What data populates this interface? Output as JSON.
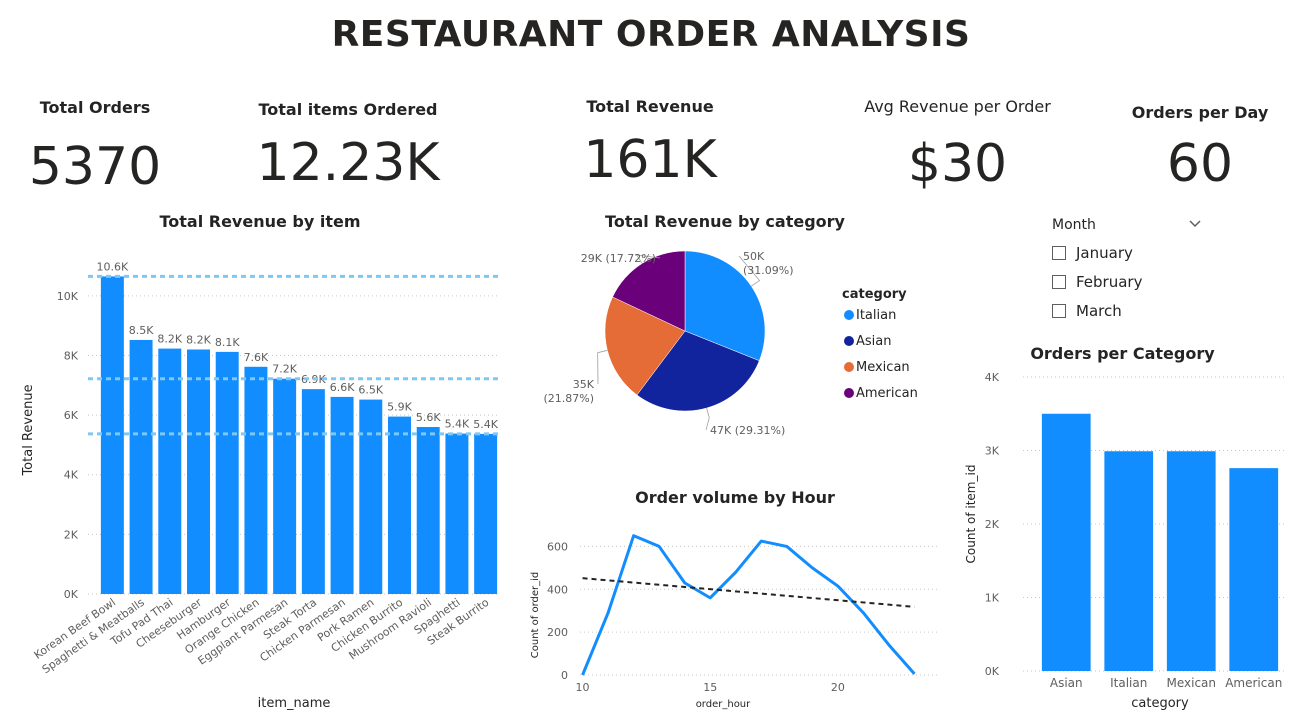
{
  "title": "RESTAURANT ORDER ANALYSIS",
  "kpis": [
    {
      "label": "Total Orders",
      "value": "5370"
    },
    {
      "label": "Total items Ordered",
      "value": "12.23K"
    },
    {
      "label": "Total Revenue",
      "value": "161K"
    },
    {
      "label": "Avg Revenue per Order",
      "value": "$30"
    },
    {
      "label": "Orders per Day",
      "value": "60"
    }
  ],
  "slicer": {
    "header": "Month",
    "options": [
      "January",
      "February",
      "March"
    ]
  },
  "colors": {
    "bar": "#118DFF",
    "italian": "#118DFF",
    "asian": "#12239E",
    "mexican": "#E66C37",
    "american": "#6B007B",
    "refline": "#7EC8F2",
    "trend": "#252423"
  },
  "chart_data": [
    {
      "type": "bar",
      "title": "Total Revenue by item",
      "xlabel": "item_name",
      "ylabel": "Total Revenue",
      "ylim": [
        0,
        11000
      ],
      "yticks": [
        0,
        2000,
        4000,
        6000,
        8000,
        10000
      ],
      "ytick_labels": [
        "0K",
        "2K",
        "4K",
        "6K",
        "8K",
        "10K"
      ],
      "categories": [
        "Korean Beef Bowl",
        "Spaghetti & Meatballs",
        "Tofu Pad Thai",
        "Cheeseburger",
        "Hamburger",
        "Orange Chicken",
        "Eggplant Parmesan",
        "Steak Torta",
        "Chicken Parmesan",
        "Pork Ramen",
        "Chicken Burrito",
        "Mushroom Ravioli",
        "Spaghetti",
        "Steak Burrito"
      ],
      "values": [
        10650,
        8520,
        8230,
        8200,
        8120,
        7620,
        7220,
        6870,
        6610,
        6520,
        5950,
        5600,
        5380,
        5370
      ],
      "data_labels": [
        "10.6K",
        "8.5K",
        "8.2K",
        "8.2K",
        "8.1K",
        "7.6K",
        "7.2K",
        "6.9K",
        "6.6K",
        "6.5K",
        "5.9K",
        "5.6K",
        "5.4K",
        "5.4K"
      ],
      "reference_lines": [
        10650,
        7220,
        5370
      ],
      "grid": true
    },
    {
      "type": "pie",
      "title": "Total Revenue by category",
      "legend_title": "category",
      "legend_position": "right",
      "slices": [
        {
          "name": "Italian",
          "value": 50000,
          "label": "50K\n(31.09%)"
        },
        {
          "name": "Asian",
          "value": 47000,
          "label": "47K (29.31%)"
        },
        {
          "name": "Mexican",
          "value": 35000,
          "label": "35K\n(21.87%)"
        },
        {
          "name": "American",
          "value": 29000,
          "label": "29K (17.72%)"
        }
      ],
      "percents": [
        31.09,
        29.31,
        21.87,
        17.72
      ]
    },
    {
      "type": "line",
      "title": "Order volume by Hour",
      "xlabel": "order_hour",
      "ylabel": "Count of order_id",
      "xlim": [
        10,
        23
      ],
      "ylim": [
        0,
        700
      ],
      "xticks": [
        10,
        15,
        20
      ],
      "yticks": [
        0,
        200,
        400,
        600
      ],
      "x": [
        10,
        11,
        12,
        13,
        14,
        15,
        16,
        17,
        18,
        19,
        20,
        21,
        22,
        23
      ],
      "y": [
        0,
        290,
        650,
        600,
        430,
        360,
        480,
        625,
        600,
        500,
        415,
        290,
        140,
        5
      ],
      "trendline": [
        [
          10,
          452
        ],
        [
          23,
          318
        ]
      ],
      "grid": true
    },
    {
      "type": "bar",
      "title": "Orders per Category",
      "xlabel": "category",
      "ylabel": "Count of item_id",
      "ylim": [
        0,
        4000
      ],
      "yticks": [
        0,
        1000,
        2000,
        3000,
        4000
      ],
      "ytick_labels": [
        "0K",
        "1K",
        "2K",
        "3K",
        "4K"
      ],
      "categories": [
        "Asian",
        "Italian",
        "Mexican",
        "American"
      ],
      "values": [
        3500,
        2990,
        2990,
        2760
      ],
      "grid": true
    }
  ]
}
